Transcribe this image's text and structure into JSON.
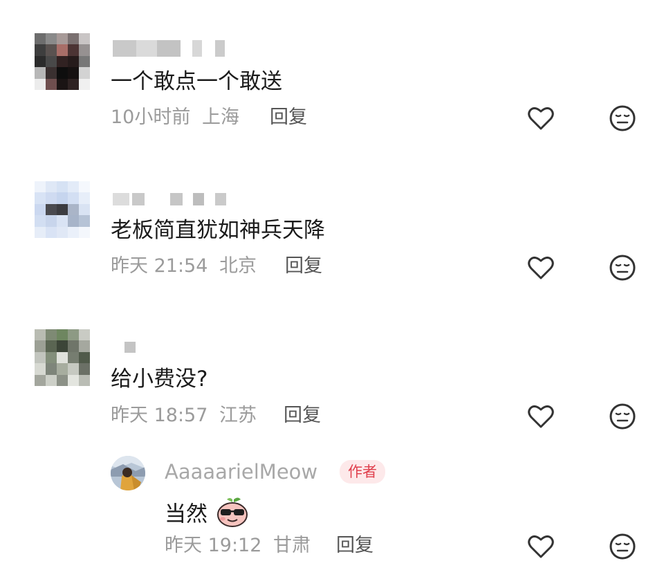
{
  "comments": [
    {
      "text": "一个敢点一个敢送",
      "time": "10小时前",
      "location": "上海",
      "reply_label": "回复"
    },
    {
      "text": "老板简直犹如神兵天降",
      "time": "昨天 21:54",
      "location": "北京",
      "reply_label": "回复"
    },
    {
      "text": "给小费没?",
      "time": "昨天 18:57",
      "location": "江苏",
      "reply_label": "回复",
      "reply": {
        "username": "AaaaarielMeow",
        "badge": "作者",
        "text": "当然",
        "time": "昨天 19:12",
        "location": "甘肃",
        "reply_label": "回复"
      }
    }
  ],
  "icons": {
    "like": "heart-outline-icon",
    "dislike": "neutral-face-icon"
  },
  "colors": {
    "text": "#1b1b1b",
    "meta": "#9b9b9b",
    "badge_bg": "#fde9ea",
    "badge_text": "#e0404d"
  }
}
